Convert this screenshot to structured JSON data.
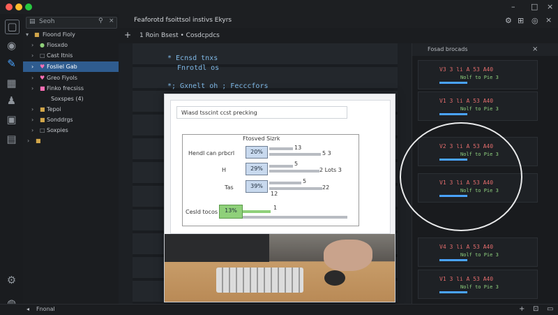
{
  "titlebar": {
    "controls": [
      "–",
      "□",
      "×"
    ]
  },
  "sidebar": {
    "search_placeholder": "Seoh",
    "items": [
      {
        "label": "Fioond Fioly"
      },
      {
        "label": "Fiosxdo"
      },
      {
        "label": "Cast Itnis"
      },
      {
        "label": "Fosliel Gab"
      },
      {
        "label": "Greo Fiyols"
      },
      {
        "label": "Finko frecsiss"
      },
      {
        "label": "Soxspes (4)"
      },
      {
        "label": "Tepoi"
      },
      {
        "label": "Sonddrgs"
      },
      {
        "label": "Soxpies"
      }
    ]
  },
  "mainhead": {
    "title": "Feaforotd fsoittsol instivs Ekyrs",
    "breadcrumb": "1 Roin Bsest • Cosdcpdcs"
  },
  "code": {
    "line1": "* Ecnsd tnxs",
    "line2": "Fnrotdl os",
    "line3": "*; Gxnelt  oh  ; Fecccfors"
  },
  "rightpanel": {
    "title": "Fosad brocads",
    "row_values": [
      "V3 3 li A 53 A40",
      "V1 3 li A 53 A40",
      "V2 3 li A 53 A40",
      "V1 3 li A 53 A40",
      "V4 3 li A 53 A40",
      "V1 3 li A 53 A40"
    ],
    "row_subs": [
      "Nolf to Pie 3",
      "Nolf to Pie 3",
      "Nolf to Pie 3",
      "Nolf to Pie 3",
      "Nolf to Pie 3",
      "Nolf to Pie 3"
    ]
  },
  "overlay": {
    "doc_title": "Wiasd tsscint ccst precking",
    "diagram": {
      "label_top": "Ftosved Sizrk",
      "label_left1": "Hendl can  prbcrl",
      "label_left2": "H",
      "label_left3": "Tas",
      "label_bottom": "Cesld tocos",
      "pcts": [
        "20%",
        "29%",
        "39%",
        "13%"
      ],
      "vals": [
        "13",
        "5 3",
        "5",
        "2  Lots 3",
        "5",
        "22",
        "12",
        "1"
      ]
    }
  },
  "statusbar": {
    "label": "Fnonal"
  }
}
